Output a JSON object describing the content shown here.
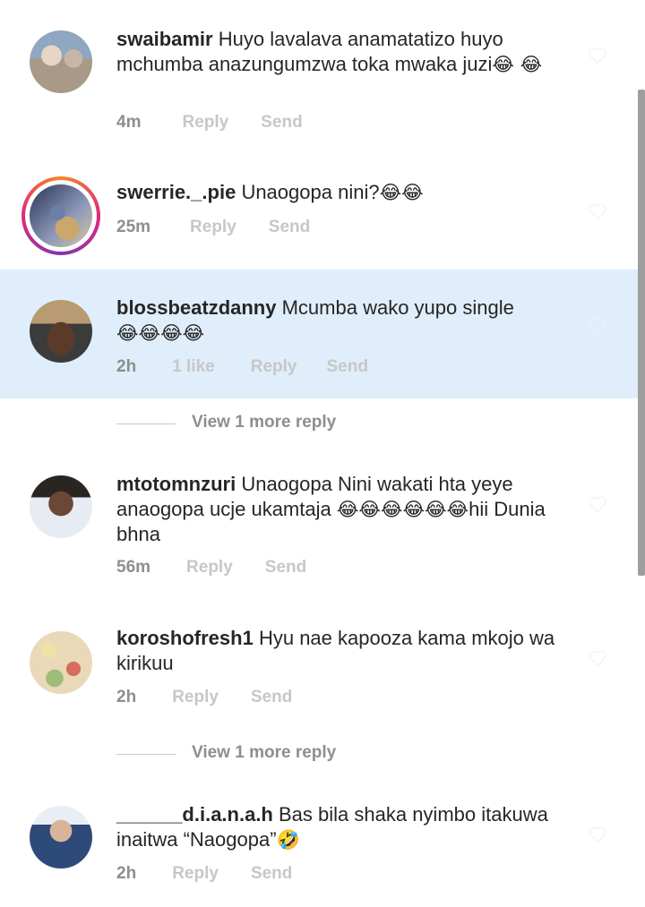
{
  "comments": [
    {
      "username": "swaibamir",
      "text": "Huyo lavalava anamatatizo huyo mchumba anazungumzwa toka mwaka juzi",
      "emoji": "😂 😂",
      "time": "4m",
      "likes": "",
      "reply": "Reply",
      "send": "Send"
    },
    {
      "username": "swerrie._.pie",
      "text": "Unaogopa nini?",
      "emoji": "😂😂",
      "time": "25m",
      "likes": "",
      "reply": "Reply",
      "send": "Send"
    },
    {
      "username": "blossbeatzdanny",
      "text": "Mcumba wako yupo single",
      "emoji": "😂😂😂😂",
      "time": "2h",
      "likes": "1 like",
      "reply": "Reply",
      "send": "Send"
    },
    {
      "username": "mtotomnzuri",
      "text": "Unaogopa Nini wakati hta yeye anaogopa ucje ukamtaja",
      "emoji": "😂😂😂😂😂😂",
      "text_after": "hii Dunia bhna",
      "time": "56m",
      "likes": "",
      "reply": "Reply",
      "send": "Send"
    },
    {
      "username": "koroshofresh1",
      "text": "Hyu nae kapooza kama mkojo wa kirikuu",
      "emoji": "",
      "time": "2h",
      "likes": "",
      "reply": "Reply",
      "send": "Send"
    },
    {
      "username": "______d.i.a.n.a.h",
      "text": "Bas bila shaka nyimbo itakuwa inaitwa “Naogopa”",
      "emoji": "🤣",
      "time": "2h",
      "likes": "",
      "reply": "Reply",
      "send": "Send"
    }
  ],
  "view_more": [
    "View 1 more reply",
    "View 1 more reply"
  ],
  "icons": {
    "like": "heart-outline-icon"
  },
  "colors": {
    "highlight": "#dfeefa",
    "muted": "#c7c7c7",
    "meta": "#8e8e8e",
    "story_ring": "#dd2a7b"
  }
}
